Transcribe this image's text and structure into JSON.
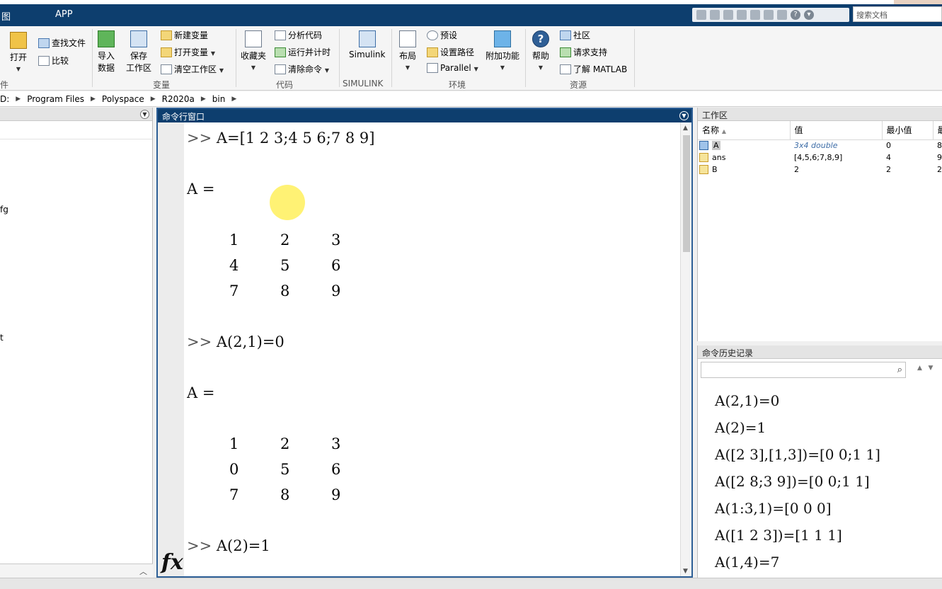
{
  "tabs": {
    "left_partial": "图",
    "app": "APP"
  },
  "search": {
    "placeholder": "搜索文档"
  },
  "ribbon": {
    "open": "打开",
    "find_files": "查找文件",
    "compare": "比较",
    "import_data_1": "导入",
    "import_data_2": "数据",
    "save_ws_1": "保存",
    "save_ws_2": "工作区",
    "new_var": "新建变量",
    "open_var": "打开变量",
    "clear_ws": "清空工作区",
    "group_file_partial": "件",
    "group_var": "变量",
    "favorites": "收藏夹",
    "analyze_code": "分析代码",
    "run_time": "运行并计时",
    "clear_cmd": "清除命令",
    "group_code": "代码",
    "simulink": "Simulink",
    "group_simulink": "SIMULINK",
    "layout": "布局",
    "preferences": "预设",
    "set_path": "设置路径",
    "parallel": "Parallel",
    "addons": "附加功能",
    "group_env": "环境",
    "help": "帮助",
    "community": "社区",
    "support": "请求支持",
    "learn": "了解 MATLAB",
    "group_resources": "资源"
  },
  "address": [
    "D:",
    "Program Files",
    "Polyspace",
    "R2020a",
    "bin"
  ],
  "left_panel": {
    "frag1": "fg",
    "frag2": "t"
  },
  "command_window": {
    "title": "命令行窗口",
    "prompt": ">>",
    "cmd1": "A=[1 2 3;4 5 6;7 8 9]",
    "out_label": "A =",
    "matrix1": [
      [
        "1",
        "2",
        "3"
      ],
      [
        "4",
        "5",
        "6"
      ],
      [
        "7",
        "8",
        "9"
      ]
    ],
    "cmd2": "A(2,1)=0",
    "matrix2": [
      [
        "1",
        "2",
        "3"
      ],
      [
        "0",
        "5",
        "6"
      ],
      [
        "7",
        "8",
        "9"
      ]
    ],
    "cmd3": "A(2)=1",
    "fx": "fx"
  },
  "workspace": {
    "title": "工作区",
    "headers": {
      "name": "名称",
      "value": "值",
      "min": "最小值",
      "max": "最"
    },
    "rows": [
      {
        "name": "A",
        "value": "3x4 double",
        "min": "0",
        "max": "8"
      },
      {
        "name": "ans",
        "value": "[4,5,6;7,8,9]",
        "min": "4",
        "max": "9"
      },
      {
        "name": "B",
        "value": "2",
        "min": "2",
        "max": "2"
      }
    ]
  },
  "history": {
    "title": "命令历史记录",
    "items": [
      "A(2,1)=0",
      "A(2)=1",
      "A([2 3],[1,3])=[0 0;1 1]",
      "A([2 8;3 9])=[0 0;1 1]",
      "A(1:3,1)=[0 0 0]",
      "A([1 2 3])=[1 1 1]",
      "A(1,4)=7"
    ]
  }
}
